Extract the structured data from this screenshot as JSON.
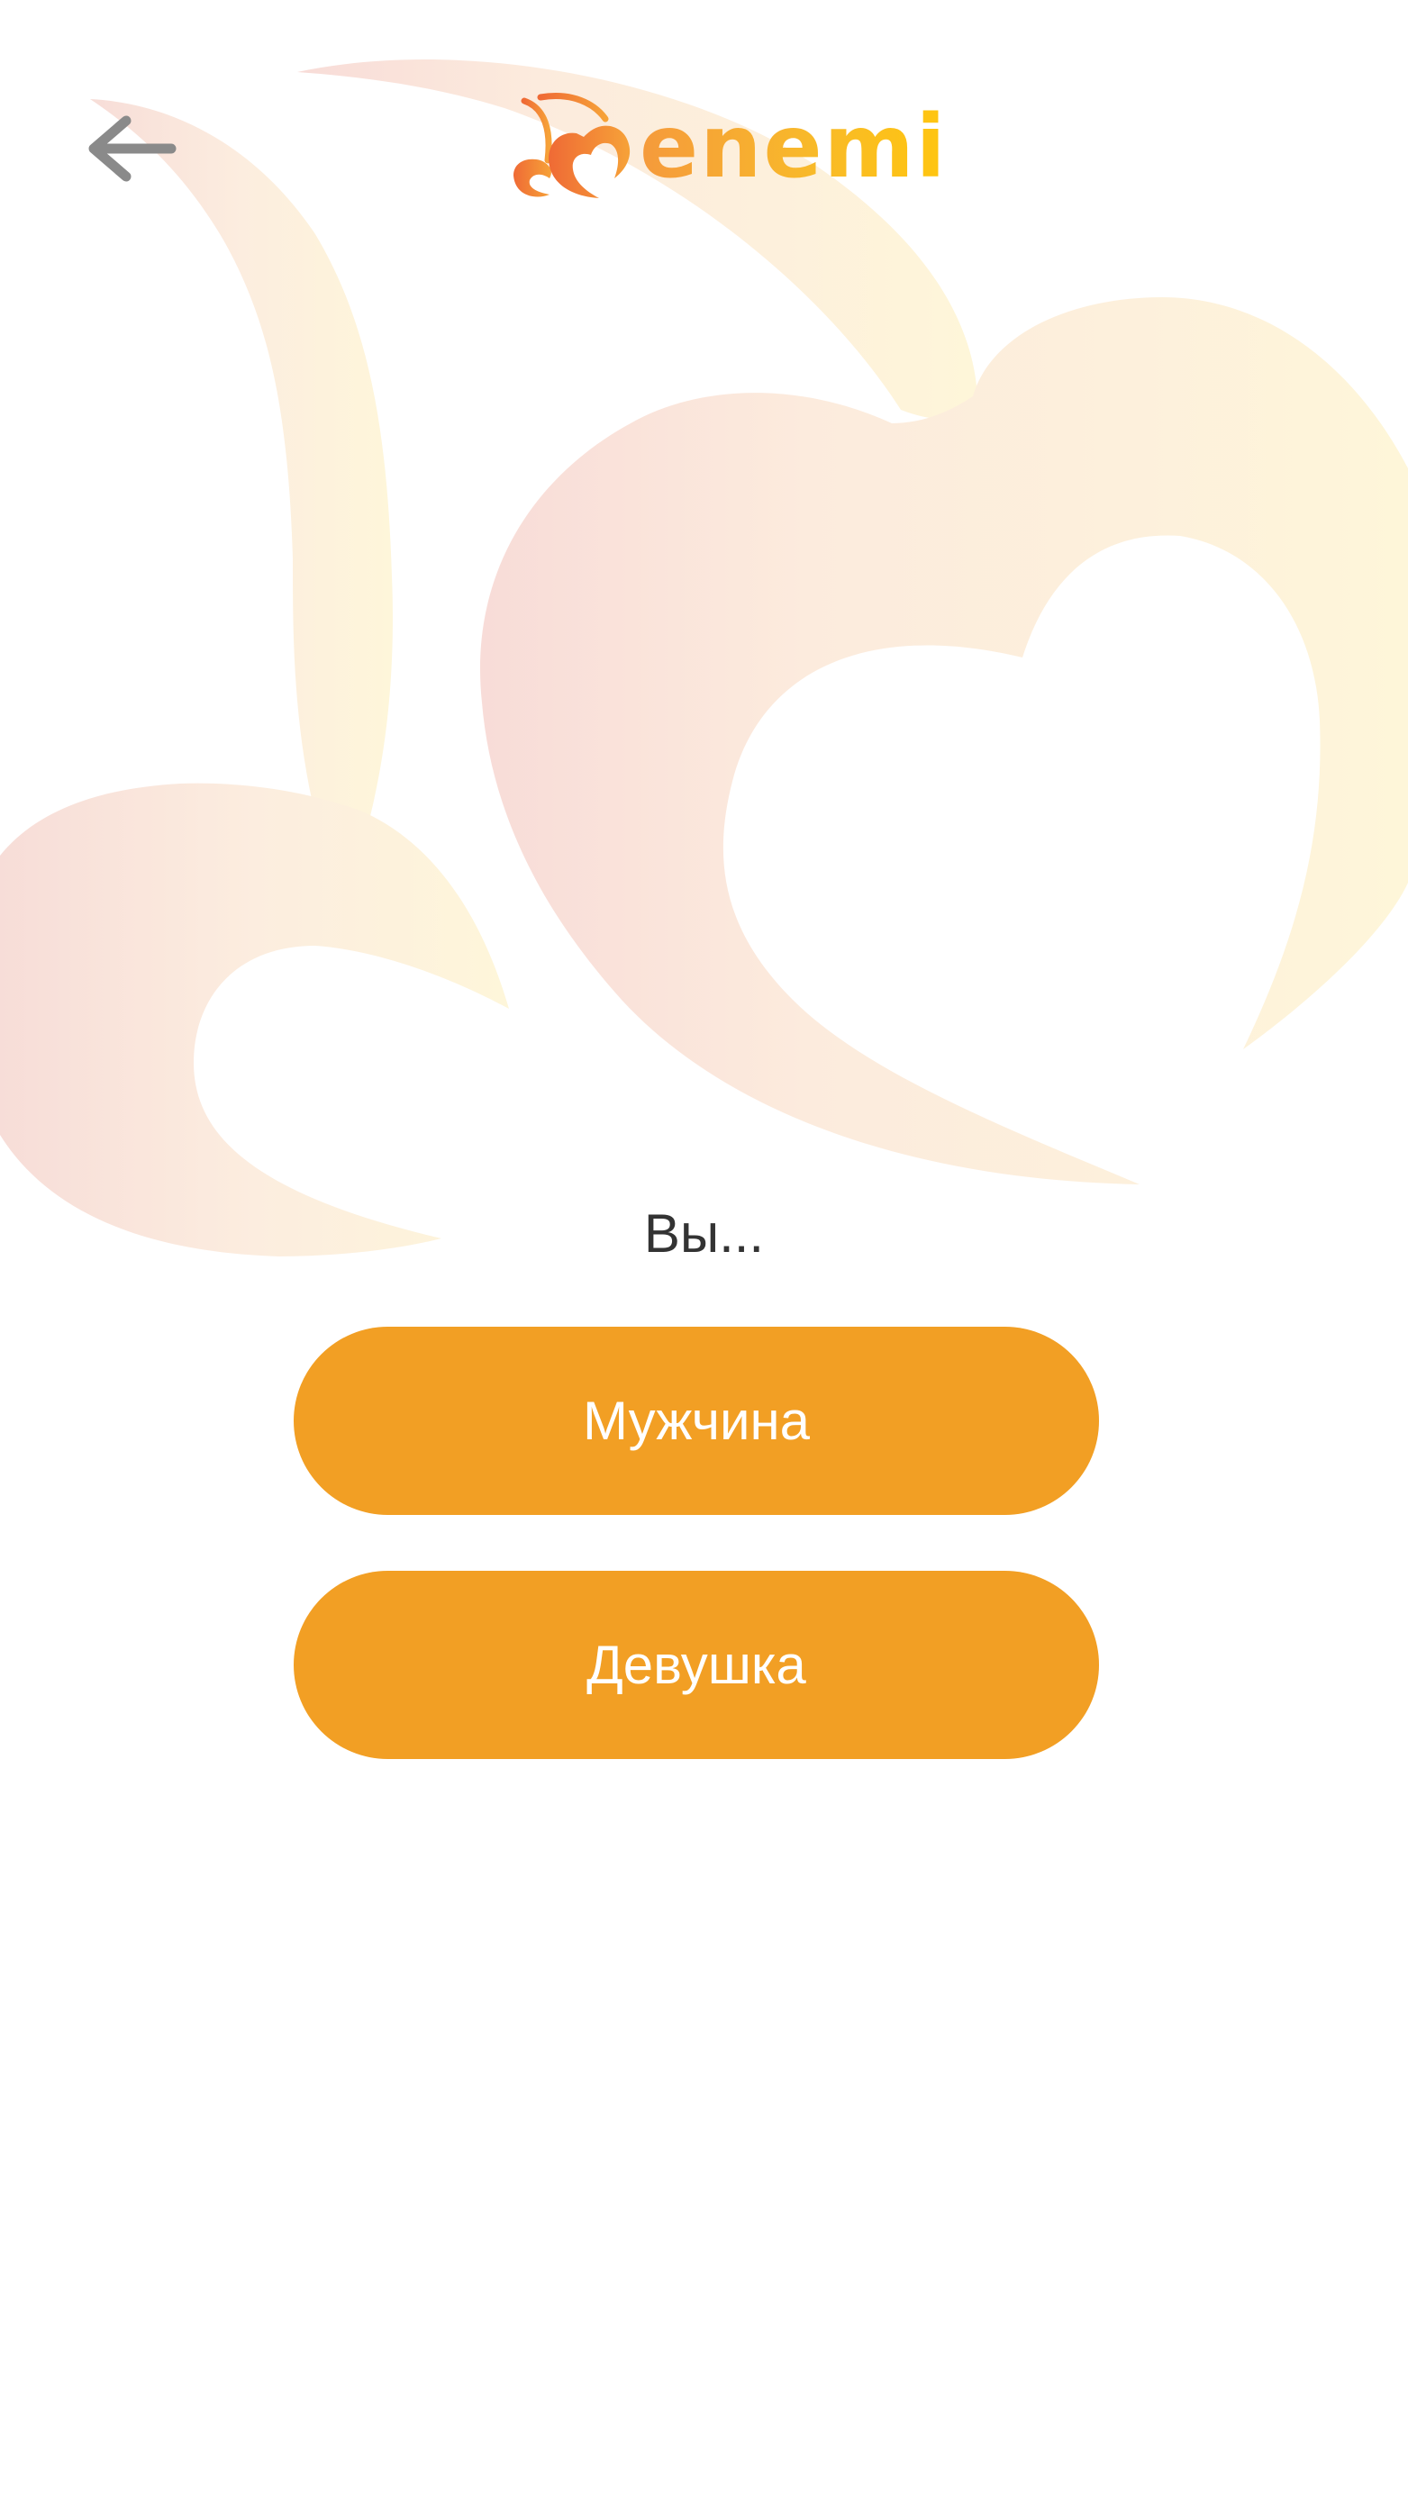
{
  "app": {
    "logo_text": "enemi"
  },
  "header": {
    "back_icon": "arrow-left-icon"
  },
  "prompt": {
    "question": "Вы..."
  },
  "options": {
    "male_label": "Мужчина",
    "female_label": "Девушка"
  },
  "colors": {
    "accent": "#F29F24",
    "logo_orange": "#F07C3A",
    "logo_yellow": "#FFC60F",
    "back_icon": "#8A8A8A",
    "text": "#333333",
    "background": "#FFFFFF"
  }
}
